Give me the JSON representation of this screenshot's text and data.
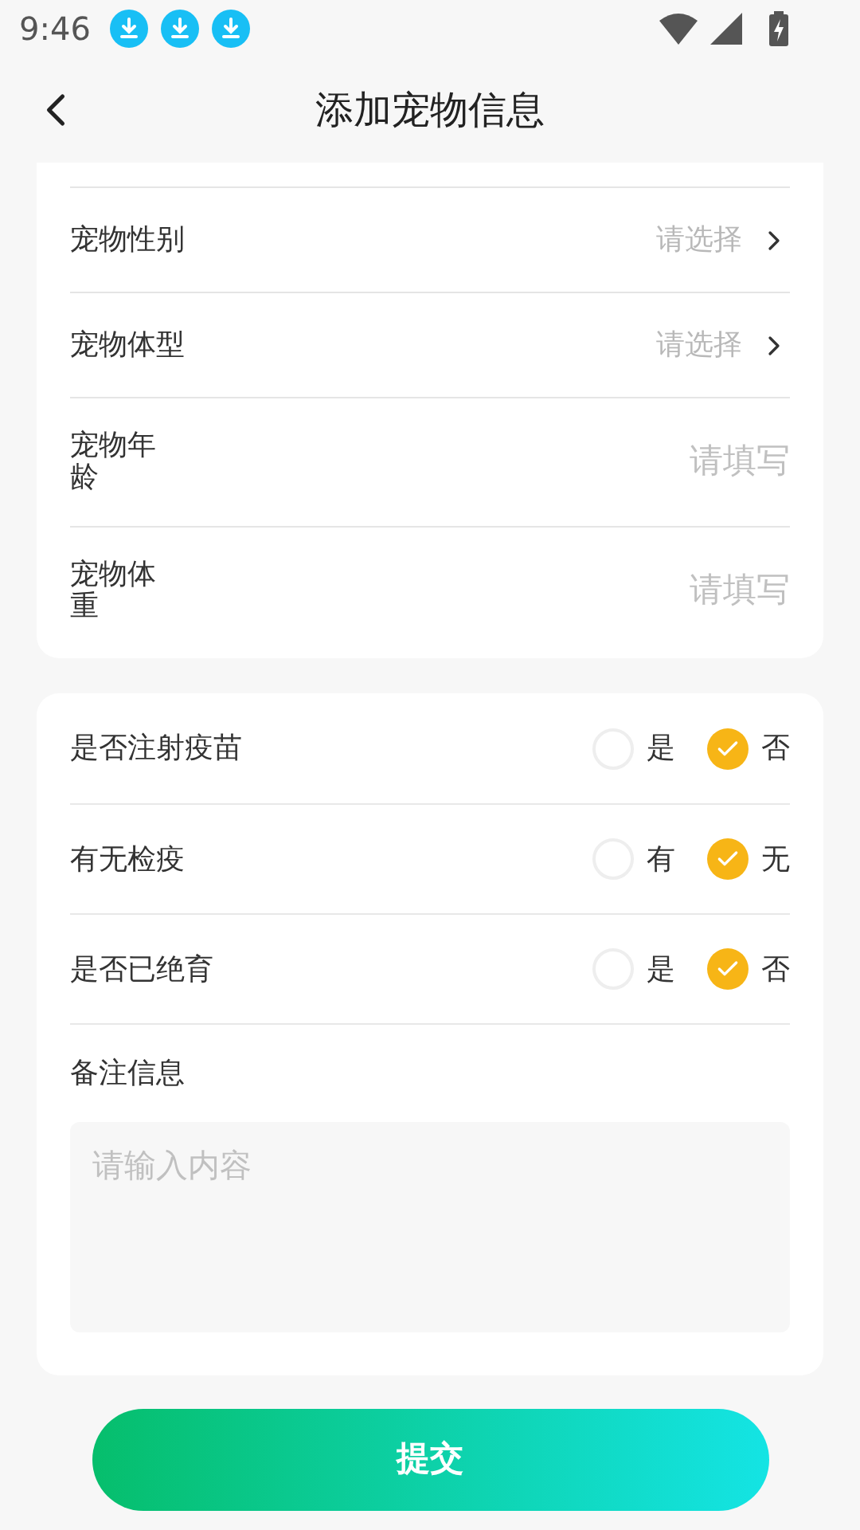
{
  "status_bar": {
    "time": "9:46",
    "notifications": [
      {
        "kind": "download"
      },
      {
        "kind": "download"
      },
      {
        "kind": "download"
      }
    ]
  },
  "header": {
    "title": "添加宠物信息"
  },
  "basic_fields": [
    {
      "kind": "select",
      "label": "宠物性别",
      "placeholder": "请选择"
    },
    {
      "kind": "select",
      "label": "宠物体型",
      "placeholder": "请选择"
    },
    {
      "kind": "input",
      "label": "宠物年龄",
      "placeholder": "请填写"
    },
    {
      "kind": "input",
      "label": "宠物体重",
      "placeholder": "请填写"
    }
  ],
  "questions": [
    {
      "label": "是否注射疫苗",
      "options": [
        {
          "label": "是",
          "selected": false
        },
        {
          "label": "否",
          "selected": true
        }
      ]
    },
    {
      "label": "有无检疫",
      "options": [
        {
          "label": "有",
          "selected": false
        },
        {
          "label": "无",
          "selected": true
        }
      ]
    },
    {
      "label": "是否已绝育",
      "options": [
        {
          "label": "是",
          "selected": false
        },
        {
          "label": "否",
          "selected": true
        }
      ]
    }
  ],
  "remarks": {
    "label": "备注信息",
    "placeholder": "请输入内容"
  },
  "submit": {
    "label": "提交"
  }
}
